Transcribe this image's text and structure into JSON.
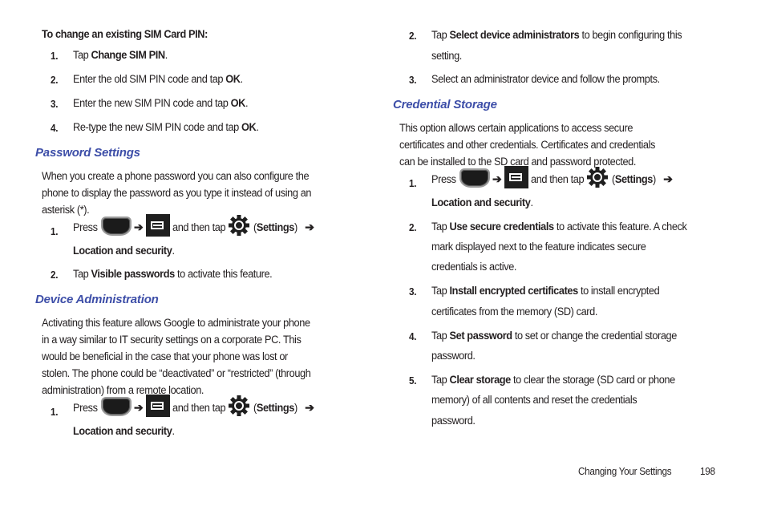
{
  "left": {
    "sim_pin": {
      "heading": "To change an existing SIM Card PIN:",
      "steps": [
        {
          "num": "1.",
          "pre": "Tap ",
          "bold": "Change SIM PIN",
          "post": "."
        },
        {
          "num": "2.",
          "pre": "Enter the old SIM PIN code and tap ",
          "bold": "OK",
          "post": "."
        },
        {
          "num": "3.",
          "pre": "Enter the new SIM PIN code and tap ",
          "bold": "OK",
          "post": "."
        },
        {
          "num": "4.",
          "pre": "Re-type the new SIM PIN code and tap ",
          "bold": "OK",
          "post": "."
        }
      ]
    },
    "password_settings": {
      "heading": "Password Settings",
      "paragraph": [
        "When you create a phone password you can also configure the",
        "phone to display the password as you type it instead of using an",
        "asterisk (*)."
      ],
      "step1": {
        "num": "1.",
        "press": "Press",
        "arrow": "➔",
        "then_tap": "and then tap",
        "settings_open": "(",
        "settings": "Settings",
        "settings_close": ")",
        "arrow2": "➔",
        "location": "Location and security",
        "period": "."
      },
      "step2": {
        "num": "2.",
        "pre": "Tap ",
        "bold": "Visible passwords",
        "post": " to activate this feature."
      }
    },
    "device_admin": {
      "heading": "Device Administration",
      "paragraph": [
        "Activating this feature allows Google to administrate your phone",
        "in a way similar to IT security settings on a corporate PC. This",
        "would be beneficial in the case that your phone was lost or",
        "stolen. The phone could be “deactivated” or “restricted” (through",
        "administration) from a remote location."
      ],
      "step1": {
        "num": "1.",
        "press": "Press",
        "arrow": "➔",
        "then_tap": "and then tap",
        "settings_open": "(",
        "settings": "Settings",
        "settings_close": ")",
        "arrow2": "➔",
        "location": "Location and security",
        "period": "."
      }
    }
  },
  "right": {
    "device_admin_cont": {
      "step2": {
        "num": "2.",
        "pre": "Tap ",
        "bold": "Select device administrators",
        "post": " to begin configuring this",
        "line2": "setting."
      },
      "step3": {
        "num": "3.",
        "text": "Select an administrator device and follow the prompts."
      }
    },
    "credential_storage": {
      "heading": "Credential Storage",
      "paragraph": [
        "This option allows certain applications to access secure",
        "certificates and other credentials. Certificates and credentials",
        "can be installed to the SD card and password protected."
      ],
      "step1": {
        "num": "1.",
        "press": "Press",
        "arrow": "➔",
        "then_tap": "and then tap",
        "settings_open": "(",
        "settings": "Settings",
        "settings_close": ")",
        "arrow2": "➔",
        "location": "Location and security",
        "period": "."
      },
      "step2": {
        "num": "2.",
        "pre": "Tap ",
        "bold": "Use secure credentials",
        "post": " to activate this feature. A check",
        "line2": "mark displayed next to the feature indicates secure",
        "line3": "credentials is active."
      },
      "step3": {
        "num": "3.",
        "pre": "Tap ",
        "bold": "Install encrypted certificates",
        "post": " to install encrypted",
        "line2": "certificates from the memory (SD) card."
      },
      "step4": {
        "num": "4.",
        "pre": "Tap ",
        "bold": "Set password",
        "post": " to set or change the credential storage",
        "line2": "password."
      },
      "step5": {
        "num": "5.",
        "pre": "Tap ",
        "bold": "Clear storage",
        "post": " to clear the storage (SD card or phone",
        "line2": "memory) of all contents and reset the credentials",
        "line3": "password."
      }
    }
  },
  "footer": {
    "section": "Changing Your Settings",
    "page": "198"
  },
  "icons": {
    "home": "home-key-icon",
    "menu": "menu-key-icon",
    "settings": "settings-gear-icon"
  }
}
